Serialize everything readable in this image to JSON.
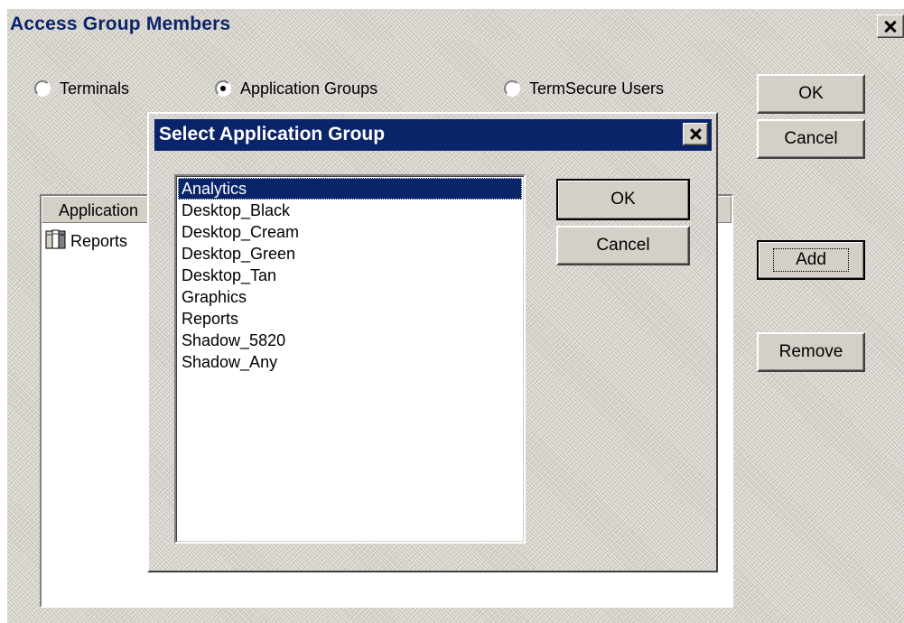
{
  "main_window": {
    "title": "Access Group Members",
    "radios": [
      {
        "label": "Terminals",
        "checked": false
      },
      {
        "label": "Application Groups",
        "checked": true
      },
      {
        "label": "TermSecure Users",
        "checked": false
      }
    ],
    "buttons": {
      "ok": "OK",
      "cancel": "Cancel",
      "add": "Add",
      "remove": "Remove"
    },
    "members_list": {
      "column_header": "Application",
      "rows": [
        {
          "label": "Reports",
          "icon": "application-group-icon"
        }
      ]
    }
  },
  "dialog": {
    "title": "Select Application Group",
    "buttons": {
      "ok": "OK",
      "cancel": "Cancel"
    },
    "items": [
      {
        "label": "Analytics",
        "selected": true
      },
      {
        "label": "Desktop_Black",
        "selected": false
      },
      {
        "label": "Desktop_Cream",
        "selected": false
      },
      {
        "label": "Desktop_Green",
        "selected": false
      },
      {
        "label": "Desktop_Tan",
        "selected": false
      },
      {
        "label": "Graphics",
        "selected": false
      },
      {
        "label": "Reports",
        "selected": false
      },
      {
        "label": "Shadow_5820",
        "selected": false
      },
      {
        "label": "Shadow_Any",
        "selected": false
      }
    ]
  },
  "colors": {
    "face": "#d4d0c8",
    "title_active": "#0a246a",
    "selection": "#0a246a"
  }
}
